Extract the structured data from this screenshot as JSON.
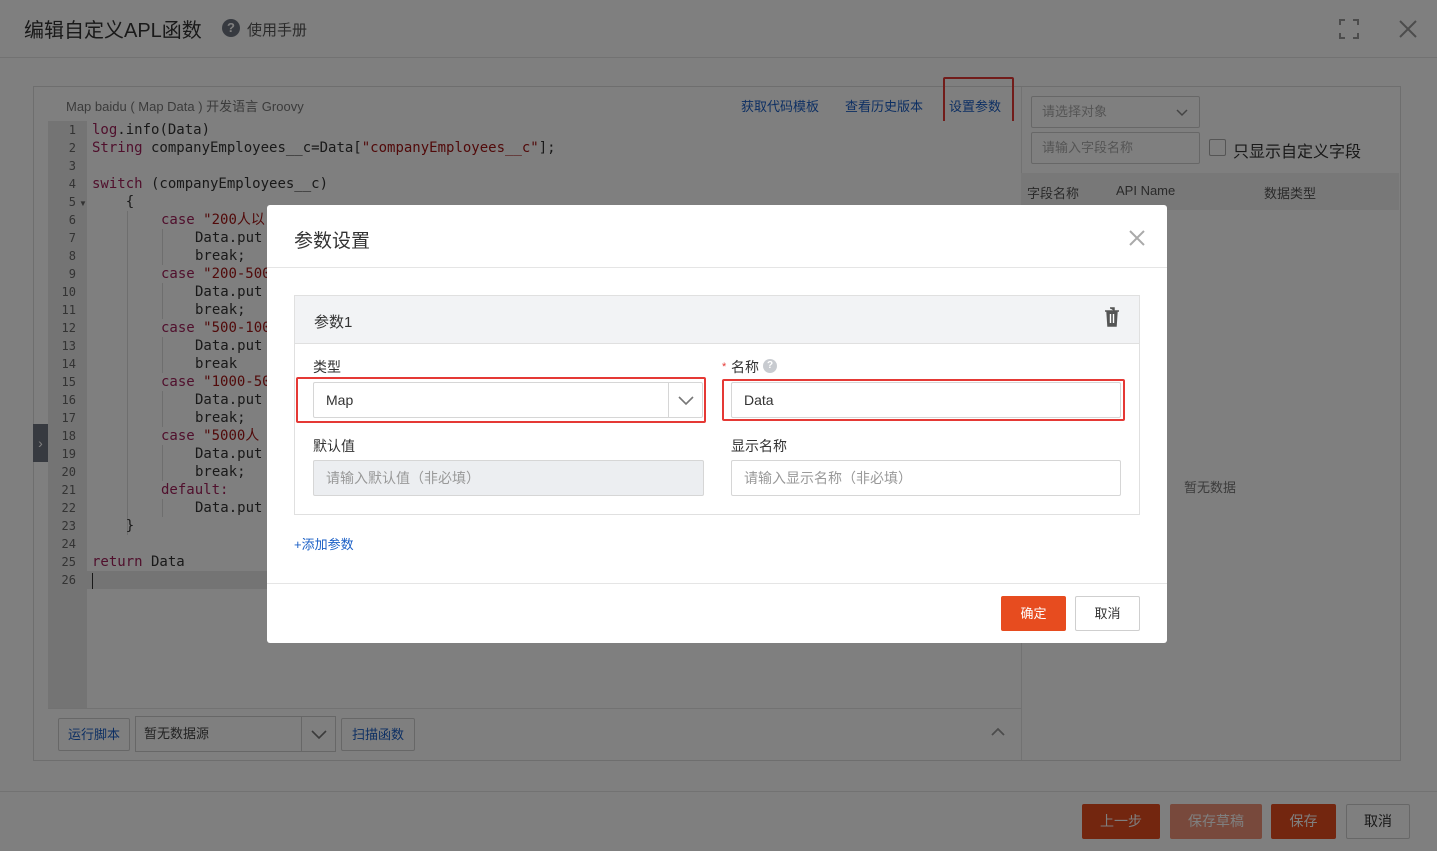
{
  "header": {
    "title": "编辑自定义APL函数",
    "help_label": "使用手册"
  },
  "editor": {
    "meta_text": "Map baidu ( Map Data )   开发语言 Groovy",
    "links": {
      "code_template": "获取代码模板",
      "history": "查看历史版本",
      "set_params": "设置参数"
    },
    "line_numbers": [
      "1",
      "2",
      "3",
      "4",
      "5",
      "6",
      "7",
      "8",
      "9",
      "10",
      "11",
      "12",
      "13",
      "14",
      "15",
      "16",
      "17",
      "18",
      "19",
      "20",
      "21",
      "22",
      "23",
      "24",
      "25",
      "26"
    ],
    "code": {
      "l1_a": "log",
      "l1_b": ".info(Data)",
      "l2_a": "String",
      "l2_b": " companyEmployees__c=Data[",
      "l2_c": "\"companyEmployees__c\"",
      "l2_d": "];",
      "l4_a": "switch",
      "l4_b": " (companyEmployees__c)",
      "l5": "    {",
      "case": "case",
      "l6_s": "\"200人以",
      "l7": "Data.put",
      "brk": "break;",
      "l9_s": "\"200-500",
      "l11_s": "\"500-100",
      "l14": "break",
      "l15_s": "\"1000-50",
      "l18_s": "\"5000人",
      "l21": "default:",
      "l23": "    }",
      "l25_a": "return",
      "l25_b": " Data"
    },
    "footer": {
      "run_label": "运行脚本",
      "datasource_value": "暂无数据源",
      "scan_label": "扫描函数"
    }
  },
  "right_panel": {
    "object_placeholder": "请选择对象",
    "field_placeholder": "请输入字段名称",
    "only_custom_label": "只显示自定义字段",
    "columns": [
      "字段名称",
      "API Name",
      "数据类型"
    ],
    "empty_text": "暂无数据"
  },
  "bottom": {
    "prev_label": "上一步",
    "draft_label": "保存草稿",
    "save_label": "保存",
    "cancel_label": "取消"
  },
  "modal": {
    "title": "参数设置",
    "param": {
      "name": "参数1",
      "type_label": "类型",
      "type_value": "Map",
      "name_label": "名称",
      "name_value": "Data",
      "default_label": "默认值",
      "default_placeholder": "请输入默认值（非必填）",
      "display_label": "显示名称",
      "display_placeholder": "请输入显示名称（非必填）"
    },
    "add_param_label": "+添加参数",
    "confirm_label": "确定",
    "cancel_label": "取消"
  },
  "colors": {
    "primary": "#e74c1f",
    "link": "#1a5fc6",
    "highlight": "#e53935"
  }
}
